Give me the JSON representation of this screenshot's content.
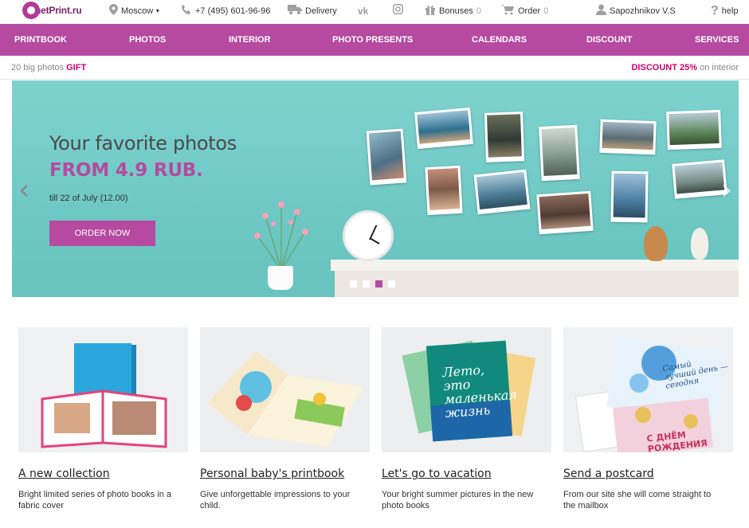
{
  "header": {
    "logo_text": "netPrint.ru",
    "city": "Moscow",
    "phone": "+7 (495) 601-96-96",
    "delivery": "Delivery",
    "social": [
      "vk-icon",
      "instagram-icon"
    ],
    "bonuses_label": "Bonuses",
    "bonuses_count": "0",
    "order_label": "Order",
    "order_count": "0",
    "user_name": "Sapozhnikov V.S",
    "help": "help"
  },
  "nav": {
    "items": [
      "PRINTBOOK",
      "PHOTOS",
      "INTERIOR",
      "PHOTO PRESENTS",
      "CALENDARS",
      "DISCOUNT",
      "SERVICES"
    ]
  },
  "promo": {
    "left_text": "20 big photos",
    "left_highlight": "GIFT",
    "right_highlight": "DISCOUNT 25%",
    "right_text": "on interior"
  },
  "hero": {
    "title": "Your favorite photos",
    "price": "FROM 4.9 RUB.",
    "date": "till 22 of July (12.00)",
    "button": "ORDER NOW",
    "active_slide": 3,
    "slide_count": 4
  },
  "cards": [
    {
      "title": "A new collection",
      "desc": "Bright limited series of photo books in a fabric cover"
    },
    {
      "title": "Personal baby's printbook",
      "desc": "Give unforgettable impressions to your child."
    },
    {
      "title": "Let's go to vacation",
      "desc": "Your bright summer pictures in the new photo books"
    },
    {
      "title": "Send a postcard",
      "desc": "From our site she will come straight to the mailbox"
    }
  ],
  "colors": {
    "brand": "#b54aa0",
    "highlight": "#d6006f",
    "hero_bg": "#76cbc8"
  }
}
